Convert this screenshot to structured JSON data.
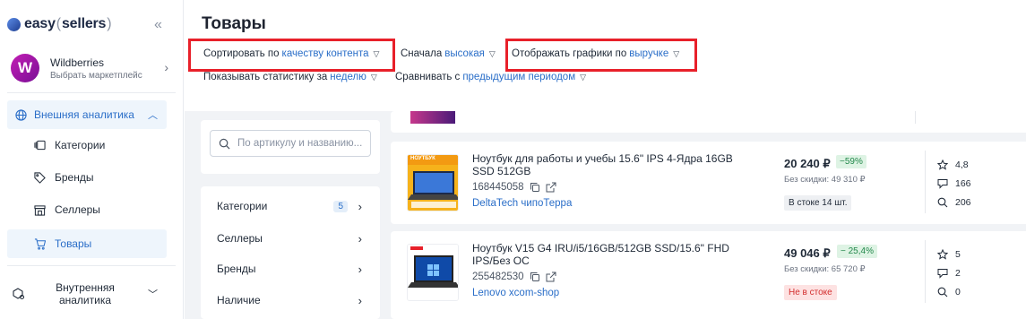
{
  "sidebar": {
    "brand_a": "easy",
    "brand_b": "sellers",
    "collapse_glyph": "«",
    "marketplace": {
      "logo": "W",
      "name": "Wildberries",
      "sub": "Выбрать маркетплейс"
    },
    "group": {
      "label": "Внешняя аналитика",
      "icon": "globe-icon"
    },
    "items": [
      {
        "label": "Категории",
        "icon": "categories-icon"
      },
      {
        "label": "Бренды",
        "icon": "tag-icon"
      },
      {
        "label": "Селлеры",
        "icon": "store-icon"
      },
      {
        "label": "Товары",
        "icon": "cart-icon",
        "active": true
      }
    ],
    "bottom": {
      "label": "Внутренняя аналитика",
      "icon": "box-gear-icon"
    }
  },
  "header": {
    "title": "Товары",
    "filters": {
      "sort_prefix": "Сортировать по",
      "sort_value": "качеству контента",
      "order_prefix": "Сначала",
      "order_value": "высокая",
      "chart_prefix": "Отображать графики по",
      "chart_value": "выручке",
      "stats_prefix": "Показывать статистику за",
      "stats_value": "неделю",
      "compare_prefix": "Сравнивать с",
      "compare_value": "предыдущим периодом"
    },
    "highlight_color": "#e8202a"
  },
  "search": {
    "placeholder": "По артикулу и названию..."
  },
  "filter_panel": [
    {
      "label": "Категории",
      "badge": "5"
    },
    {
      "label": "Селлеры"
    },
    {
      "label": "Бренды"
    },
    {
      "label": "Наличие"
    }
  ],
  "products": [
    {
      "title": "Ноутбук для работы и учебы 15.6\" IPS 4-Ядра 16GB SSD 512GB",
      "sku": "168445058",
      "seller": "DeltaTech чипоТерра",
      "price": "20 240 ₽",
      "discount": "−59%",
      "old_price": "Без скидки: 49 310 ₽",
      "stock": "В стоке 14 шт.",
      "stock_status": "in",
      "rating": "4,8",
      "reviews": "166",
      "questions": "206",
      "thumb_label": "НОУТБУК"
    },
    {
      "title": "Ноутбук V15 G4 IRU/i5/16GB/512GB SSD/15.6\" FHD IPS/Без ОС",
      "sku": "255482530",
      "seller": "Lenovo xcom-shop",
      "price": "49 046 ₽",
      "discount": "− 25,4%",
      "old_price": "Без скидки: 65 720 ₽",
      "stock": "Не в стоке",
      "stock_status": "out",
      "rating": "5",
      "reviews": "2",
      "questions": "0"
    }
  ],
  "colors": {
    "accent": "#2a6ec8",
    "discount_bg": "#def3e4",
    "out_of_stock": "#d32f2f"
  }
}
